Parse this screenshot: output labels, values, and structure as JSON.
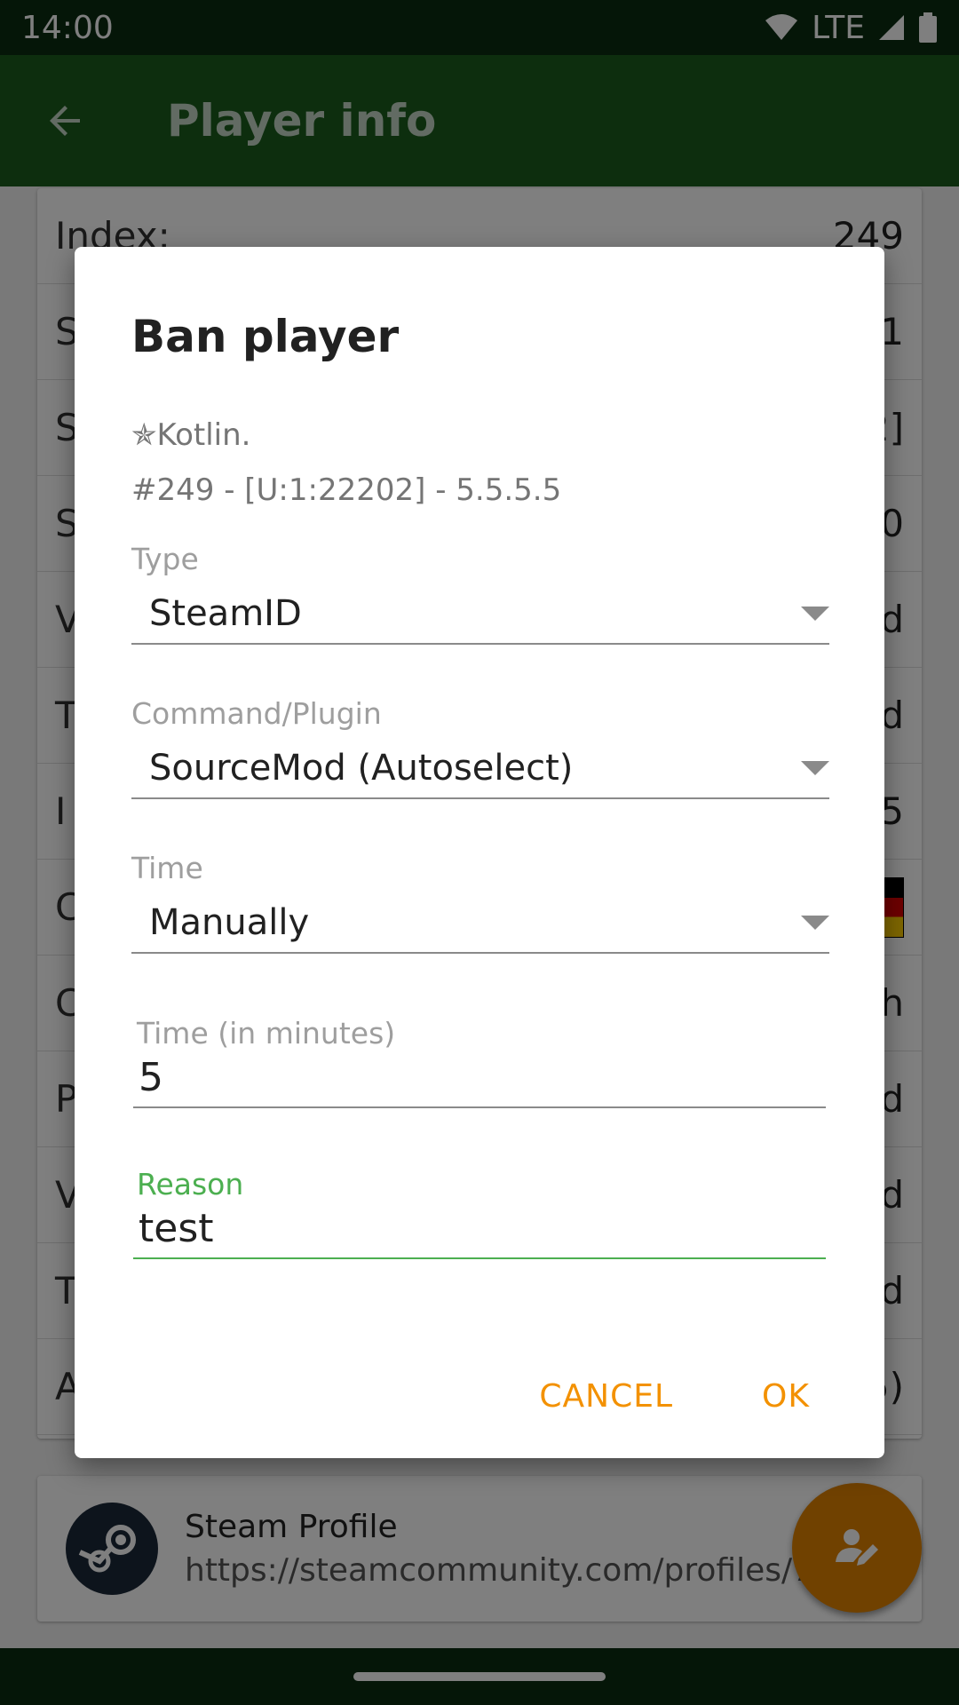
{
  "status": {
    "time": "14:00",
    "network": "LTE"
  },
  "appbar": {
    "title": "Player info"
  },
  "rows": [
    {
      "label": "Index:",
      "value": "249"
    },
    {
      "label": "S",
      "value": "1"
    },
    {
      "label": "S",
      "value": "2]"
    },
    {
      "label": "S",
      "value": "0"
    },
    {
      "label": "V",
      "value": "d"
    },
    {
      "label": "T",
      "value": "d"
    },
    {
      "label": "I",
      "value": "5"
    },
    {
      "label": "C",
      "value": ""
    },
    {
      "label": "C",
      "value": "h"
    },
    {
      "label": "P",
      "value": "d"
    },
    {
      "label": "V",
      "value": "d"
    },
    {
      "label": "T",
      "value": "d"
    },
    {
      "label": "A",
      "value": "5)"
    }
  ],
  "profile": {
    "title": "Steam Profile",
    "url": "https://steamcommunity.com/profiles/765"
  },
  "dialog": {
    "title": "Ban player",
    "player_name": "✯Kotlin.",
    "player_info": "#249 - [U:1:22202] - 5.5.5.5",
    "type": {
      "label": "Type",
      "value": "SteamID"
    },
    "command": {
      "label": "Command/Plugin",
      "value": "SourceMod (Autoselect)"
    },
    "time": {
      "label": "Time",
      "value": "Manually"
    },
    "minutes": {
      "label": "Time (in minutes)",
      "value": "5"
    },
    "reason": {
      "label": "Reason",
      "value": "test"
    },
    "cancel_label": "CANCEL",
    "ok_label": "OK"
  },
  "colors": {
    "appbar": "#1a5d1d",
    "accent": "#f39100",
    "focus": "#4caf50",
    "fab": "#e08300"
  },
  "icons": {
    "back": "arrow-back-icon",
    "fab": "edit-user-icon",
    "steam": "steam-logo-icon"
  }
}
